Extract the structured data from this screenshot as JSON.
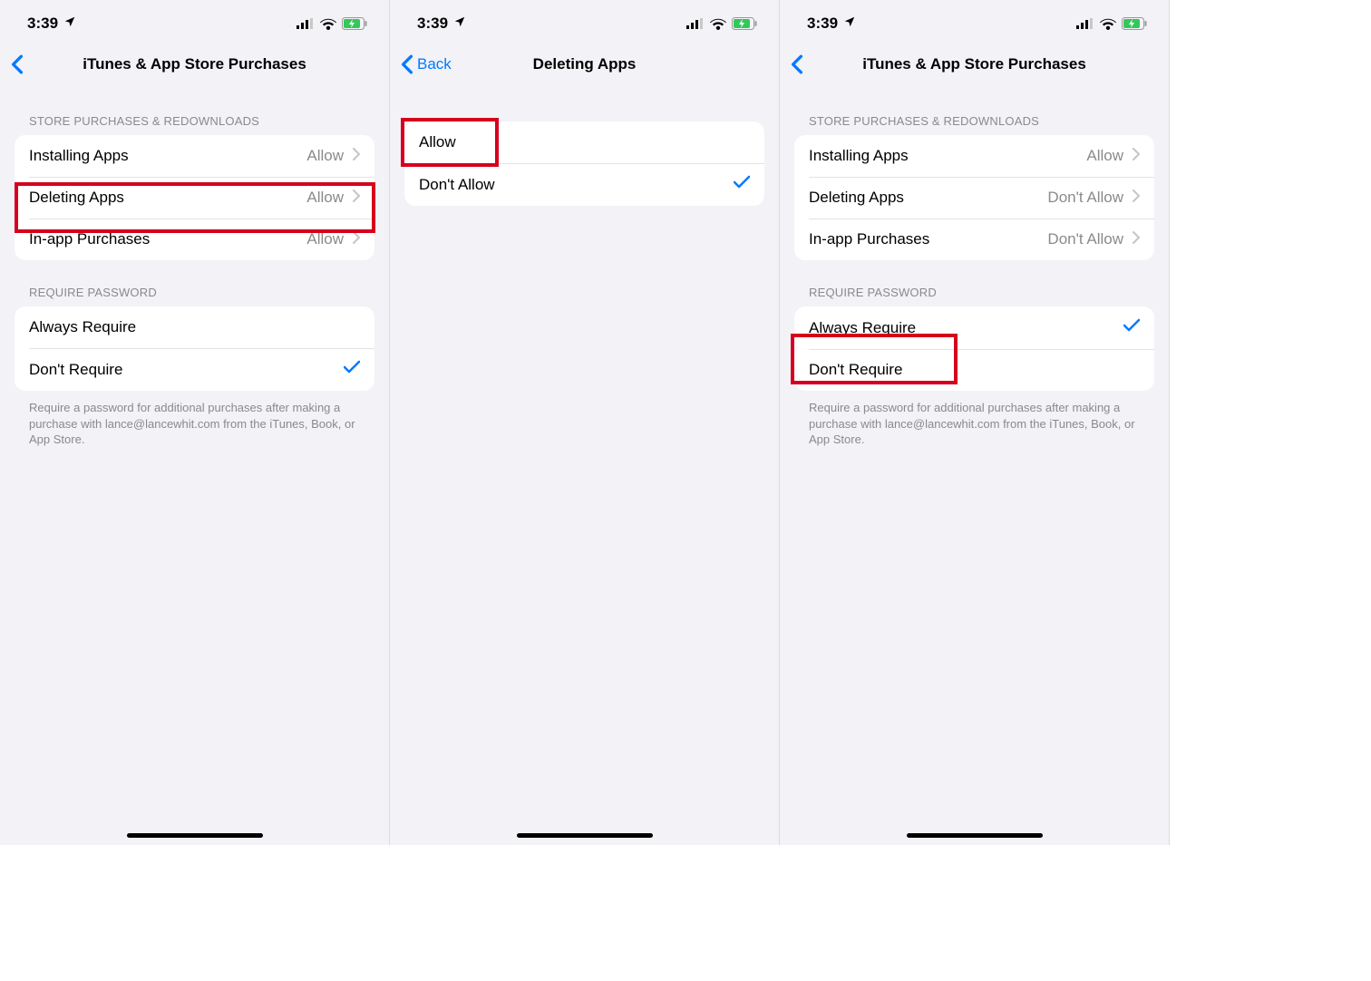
{
  "status": {
    "time": "3:39",
    "location_icon": "location-arrow-icon",
    "signal": "signal-icon",
    "wifi": "wifi-icon",
    "battery": "battery-charging-icon"
  },
  "screens": [
    {
      "nav": {
        "back_label": "",
        "title": "iTunes & App Store Purchases"
      },
      "sections": [
        {
          "header": "STORE PURCHASES & REDOWNLOADS",
          "rows": [
            {
              "label": "Installing Apps",
              "value": "Allow",
              "chevron": true
            },
            {
              "label": "Deleting Apps",
              "value": "Allow",
              "chevron": true
            },
            {
              "label": "In-app Purchases",
              "value": "Allow",
              "chevron": true
            }
          ]
        },
        {
          "header": "REQUIRE PASSWORD",
          "rows": [
            {
              "label": "Always Require",
              "checked": false
            },
            {
              "label": "Don't Require",
              "checked": true
            }
          ],
          "footer": "Require a password for additional purchases after making a purchase with lance@lancewhit.com from the iTunes, Book, or App Store."
        }
      ],
      "highlight_row": {
        "section": 0,
        "row": 1
      }
    },
    {
      "nav": {
        "back_label": "Back",
        "title": "Deleting Apps"
      },
      "sections": [
        {
          "header": "",
          "rows": [
            {
              "label": "Allow",
              "checked": false
            },
            {
              "label": "Don't Allow",
              "checked": true
            }
          ]
        }
      ],
      "highlight_row": {
        "section": 0,
        "row": 0,
        "tight": true
      }
    },
    {
      "nav": {
        "back_label": "",
        "title": "iTunes & App Store Purchases"
      },
      "sections": [
        {
          "header": "STORE PURCHASES & REDOWNLOADS",
          "rows": [
            {
              "label": "Installing Apps",
              "value": "Allow",
              "chevron": true
            },
            {
              "label": "Deleting Apps",
              "value": "Don't Allow",
              "chevron": true
            },
            {
              "label": "In-app Purchases",
              "value": "Don't Allow",
              "chevron": true
            }
          ]
        },
        {
          "header": "REQUIRE PASSWORD",
          "rows": [
            {
              "label": "Always Require",
              "checked": true
            },
            {
              "label": "Don't Require",
              "checked": false
            }
          ],
          "footer": "Require a password for additional purchases after making a purchase with lance@lancewhit.com from the iTunes, Book, or App Store."
        }
      ],
      "highlight_row": {
        "section": 1,
        "row": 0,
        "tight": true
      }
    }
  ]
}
